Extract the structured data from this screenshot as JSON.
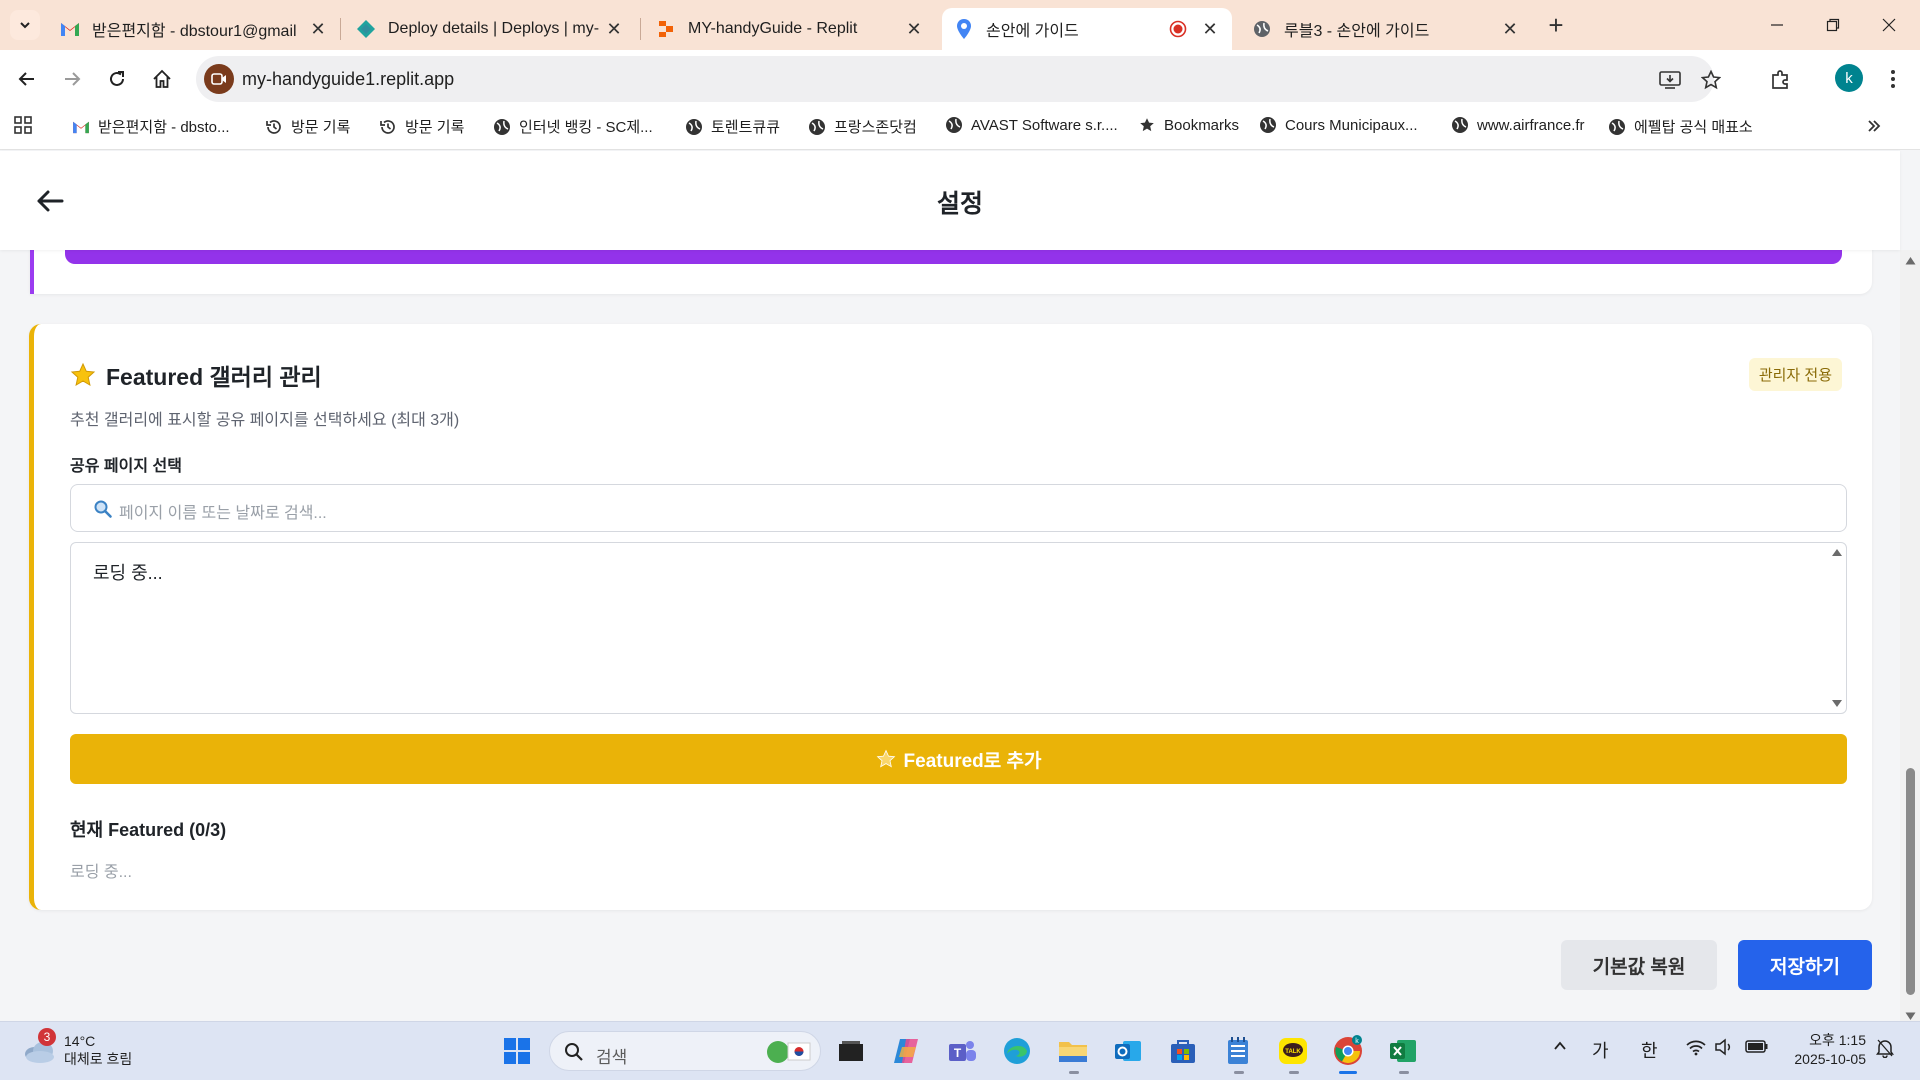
{
  "browser": {
    "tabs": [
      {
        "title": "받은편지함 - dbstour1@gmail",
        "favicon": "gmail-icon"
      },
      {
        "title": "Deploy details | Deploys | my-",
        "favicon": "netlify-icon"
      },
      {
        "title": "MY-handyGuide - Replit",
        "favicon": "replit-icon"
      },
      {
        "title": "손안에 가이드",
        "favicon": "location-pin-icon",
        "active": true,
        "recording": true
      },
      {
        "title": "루블3 - 손안에 가이드",
        "favicon": "globe-icon"
      }
    ],
    "url": "my-handyguide1.replit.app",
    "profile_initial": "k",
    "bookmarks": [
      {
        "label": "받은편지함 - dbsto...",
        "icon": "gmail-icon"
      },
      {
        "label": "방문 기록",
        "icon": "history-icon"
      },
      {
        "label": "방문 기록",
        "icon": "history-icon"
      },
      {
        "label": "인터넷 뱅킹 - SC제...",
        "icon": "globe-icon"
      },
      {
        "label": "토렌트큐큐",
        "icon": "globe-icon"
      },
      {
        "label": "프랑스존닷컴",
        "icon": "globe-icon"
      },
      {
        "label": "AVAST Software s.r....",
        "icon": "globe-icon"
      },
      {
        "label": "Bookmarks",
        "icon": "star-icon"
      },
      {
        "label": "Cours Municipaux...",
        "icon": "globe-icon"
      },
      {
        "label": "www.airfrance.fr",
        "icon": "globe-icon"
      },
      {
        "label": "에펠탑 공식 매표소",
        "icon": "globe-icon"
      }
    ]
  },
  "app": {
    "page_title": "설정",
    "featured": {
      "title": "Featured 갤러리 관리",
      "badge": "관리자 전용",
      "description": "추천 갤러리에 표시할 공유 페이지를 선택하세요 (최대 3개)",
      "select_label": "공유 페이지 선택",
      "search_placeholder": "페이지 이름 또는 날짜로 검색...",
      "list_loading": "로딩 중...",
      "add_button": "Featured로 추가",
      "current_label": "현재 Featured (0/3)",
      "current_loading": "로딩 중..."
    },
    "reset_button": "기본값 복원",
    "save_button": "저장하기",
    "colors": {
      "accent_yellow": "#eab308",
      "accent_purple": "#9333ea",
      "primary_blue": "#2563eb"
    }
  },
  "taskbar": {
    "weather_temp": "14°C",
    "weather_desc": "대체로 흐림",
    "notification_count": "3",
    "search_placeholder": "검색",
    "ime_mode1": "가",
    "ime_mode2": "한",
    "time": "오후 1:15",
    "date": "2025-10-05"
  }
}
